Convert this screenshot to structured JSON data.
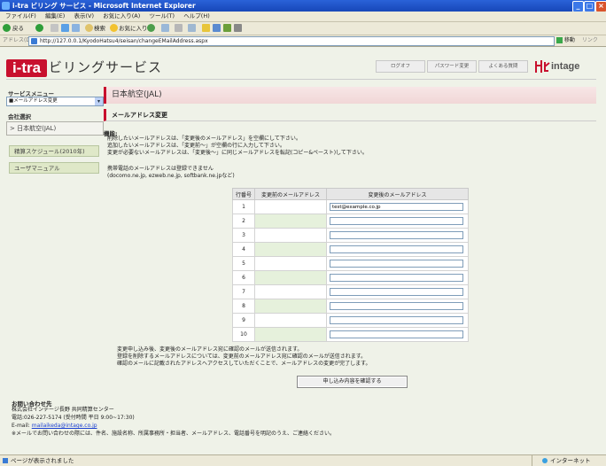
{
  "window": {
    "title": "i-tra ビリング サービス - Microsoft Internet Explorer",
    "controls": [
      "_",
      "□",
      "×"
    ]
  },
  "menubar": [
    "ファイル(F)",
    "編集(E)",
    "表示(V)",
    "お気に入り(A)",
    "ツール(T)",
    "ヘルプ(H)"
  ],
  "toolbar": {
    "back": "戻る",
    "search": "検索",
    "favorites": "お気に入り"
  },
  "address": {
    "label": "アドレス(D)",
    "url": "http://127.0.0.1/KyodoHatsu4/seisan/changeEMailAddress.aspx",
    "go": "移動",
    "links": "リンク"
  },
  "header": {
    "logo_box": "i-tra",
    "logo_rest": "ビリングサービス",
    "buttons": [
      "ログオフ",
      "パスワード変更",
      "よくある質問"
    ],
    "brand": "intage"
  },
  "sidebar": {
    "service_menu_title": "サービスメニュー",
    "service_select": "■メールアドレス変更",
    "company_title": "会社選択",
    "company_button": "> 日本航空(JAL)",
    "items": [
      "精算スケジュール(2010年)",
      "ユーザマニュアル"
    ]
  },
  "main": {
    "company_name": "日本航空(JAL)",
    "section_title": "メールアドレス変更",
    "function_label": "機能:",
    "function_lines": [
      "削除したいメールアドレスは、「変更後のメールアドレス」を空欄にして下さい。",
      "追加したいメールアドレスは、「変更前～」が空欄の行に入力して下さい。",
      "変更が必要ないメールアドレスは、「変更後～」に同じメールアドレスを転記(コピー&ペースト)して下さい。",
      "",
      "携帯電話のメールアドレスは登録できません",
      "(docomo.ne.jp, ezweb.ne.jp, softbank.ne.jpなど)"
    ],
    "table": {
      "headers": [
        "行番号",
        "変更前のメールアドレス",
        "変更後のメールアドレス"
      ],
      "rows": [
        {
          "no": "1",
          "current": "",
          "new": "test@example.co.jp"
        },
        {
          "no": "2",
          "current": "",
          "new": ""
        },
        {
          "no": "3",
          "current": "",
          "new": ""
        },
        {
          "no": "4",
          "current": "",
          "new": ""
        },
        {
          "no": "5",
          "current": "",
          "new": ""
        },
        {
          "no": "6",
          "current": "",
          "new": ""
        },
        {
          "no": "7",
          "current": "",
          "new": ""
        },
        {
          "no": "8",
          "current": "",
          "new": ""
        },
        {
          "no": "9",
          "current": "",
          "new": ""
        },
        {
          "no": "10",
          "current": "",
          "new": ""
        }
      ]
    },
    "notes": [
      "変更申し込み後、変更後のメールアドレス宛に確認のメールが送信されます。",
      "登録を削除するメールアドレスについては、変更前のメールアドレス宛に確認のメールが送信されます。",
      "確認のメールに記載されたアドレスへアクセスしていただくことで、メールアドレスの変更が完了します。"
    ],
    "confirm_button": "申し込み内容を確認する"
  },
  "contact": {
    "title": "お問い合わせ先",
    "company": "株式会社インテージ長野 共同精算センター",
    "phone": "電話:026-227-5174 (受付時間 平日 9:00~17:30)",
    "email_label": "E-mail: ",
    "email": "mailaikeda@intage.co.jp",
    "note": "※メールでお問い合わせの際には、件名、施設名称、所属事務所・担当者、メールアドレス、電話番号を明記のうえ、ご連絡ください。"
  },
  "status": {
    "left": "ページが表示されました",
    "zone": "インターネット"
  }
}
